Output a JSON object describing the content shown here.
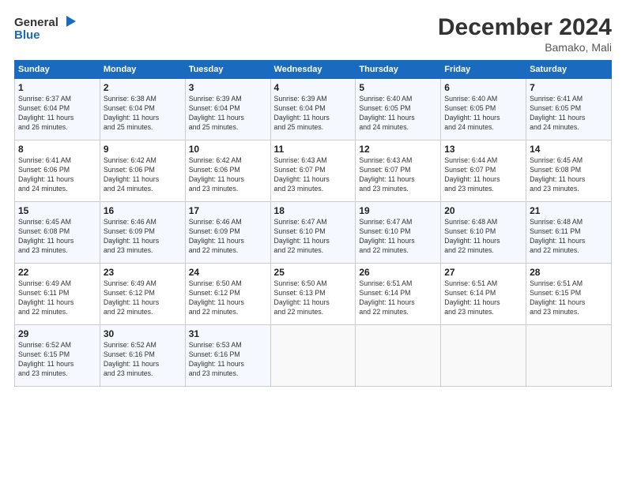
{
  "logo": {
    "line1": "General",
    "line2": "Blue"
  },
  "title": "December 2024",
  "subtitle": "Bamako, Mali",
  "days_header": [
    "Sunday",
    "Monday",
    "Tuesday",
    "Wednesday",
    "Thursday",
    "Friday",
    "Saturday"
  ],
  "weeks": [
    [
      {
        "day": "1",
        "info": "Sunrise: 6:37 AM\nSunset: 6:04 PM\nDaylight: 11 hours\nand 26 minutes."
      },
      {
        "day": "2",
        "info": "Sunrise: 6:38 AM\nSunset: 6:04 PM\nDaylight: 11 hours\nand 25 minutes."
      },
      {
        "day": "3",
        "info": "Sunrise: 6:39 AM\nSunset: 6:04 PM\nDaylight: 11 hours\nand 25 minutes."
      },
      {
        "day": "4",
        "info": "Sunrise: 6:39 AM\nSunset: 6:04 PM\nDaylight: 11 hours\nand 25 minutes."
      },
      {
        "day": "5",
        "info": "Sunrise: 6:40 AM\nSunset: 6:05 PM\nDaylight: 11 hours\nand 24 minutes."
      },
      {
        "day": "6",
        "info": "Sunrise: 6:40 AM\nSunset: 6:05 PM\nDaylight: 11 hours\nand 24 minutes."
      },
      {
        "day": "7",
        "info": "Sunrise: 6:41 AM\nSunset: 6:05 PM\nDaylight: 11 hours\nand 24 minutes."
      }
    ],
    [
      {
        "day": "8",
        "info": "Sunrise: 6:41 AM\nSunset: 6:06 PM\nDaylight: 11 hours\nand 24 minutes."
      },
      {
        "day": "9",
        "info": "Sunrise: 6:42 AM\nSunset: 6:06 PM\nDaylight: 11 hours\nand 24 minutes."
      },
      {
        "day": "10",
        "info": "Sunrise: 6:42 AM\nSunset: 6:06 PM\nDaylight: 11 hours\nand 23 minutes."
      },
      {
        "day": "11",
        "info": "Sunrise: 6:43 AM\nSunset: 6:07 PM\nDaylight: 11 hours\nand 23 minutes."
      },
      {
        "day": "12",
        "info": "Sunrise: 6:43 AM\nSunset: 6:07 PM\nDaylight: 11 hours\nand 23 minutes."
      },
      {
        "day": "13",
        "info": "Sunrise: 6:44 AM\nSunset: 6:07 PM\nDaylight: 11 hours\nand 23 minutes."
      },
      {
        "day": "14",
        "info": "Sunrise: 6:45 AM\nSunset: 6:08 PM\nDaylight: 11 hours\nand 23 minutes."
      }
    ],
    [
      {
        "day": "15",
        "info": "Sunrise: 6:45 AM\nSunset: 6:08 PM\nDaylight: 11 hours\nand 23 minutes."
      },
      {
        "day": "16",
        "info": "Sunrise: 6:46 AM\nSunset: 6:09 PM\nDaylight: 11 hours\nand 23 minutes."
      },
      {
        "day": "17",
        "info": "Sunrise: 6:46 AM\nSunset: 6:09 PM\nDaylight: 11 hours\nand 22 minutes."
      },
      {
        "day": "18",
        "info": "Sunrise: 6:47 AM\nSunset: 6:10 PM\nDaylight: 11 hours\nand 22 minutes."
      },
      {
        "day": "19",
        "info": "Sunrise: 6:47 AM\nSunset: 6:10 PM\nDaylight: 11 hours\nand 22 minutes."
      },
      {
        "day": "20",
        "info": "Sunrise: 6:48 AM\nSunset: 6:10 PM\nDaylight: 11 hours\nand 22 minutes."
      },
      {
        "day": "21",
        "info": "Sunrise: 6:48 AM\nSunset: 6:11 PM\nDaylight: 11 hours\nand 22 minutes."
      }
    ],
    [
      {
        "day": "22",
        "info": "Sunrise: 6:49 AM\nSunset: 6:11 PM\nDaylight: 11 hours\nand 22 minutes."
      },
      {
        "day": "23",
        "info": "Sunrise: 6:49 AM\nSunset: 6:12 PM\nDaylight: 11 hours\nand 22 minutes."
      },
      {
        "day": "24",
        "info": "Sunrise: 6:50 AM\nSunset: 6:12 PM\nDaylight: 11 hours\nand 22 minutes."
      },
      {
        "day": "25",
        "info": "Sunrise: 6:50 AM\nSunset: 6:13 PM\nDaylight: 11 hours\nand 22 minutes."
      },
      {
        "day": "26",
        "info": "Sunrise: 6:51 AM\nSunset: 6:14 PM\nDaylight: 11 hours\nand 22 minutes."
      },
      {
        "day": "27",
        "info": "Sunrise: 6:51 AM\nSunset: 6:14 PM\nDaylight: 11 hours\nand 23 minutes."
      },
      {
        "day": "28",
        "info": "Sunrise: 6:51 AM\nSunset: 6:15 PM\nDaylight: 11 hours\nand 23 minutes."
      }
    ],
    [
      {
        "day": "29",
        "info": "Sunrise: 6:52 AM\nSunset: 6:15 PM\nDaylight: 11 hours\nand 23 minutes."
      },
      {
        "day": "30",
        "info": "Sunrise: 6:52 AM\nSunset: 6:16 PM\nDaylight: 11 hours\nand 23 minutes."
      },
      {
        "day": "31",
        "info": "Sunrise: 6:53 AM\nSunset: 6:16 PM\nDaylight: 11 hours\nand 23 minutes."
      },
      {
        "day": "",
        "info": ""
      },
      {
        "day": "",
        "info": ""
      },
      {
        "day": "",
        "info": ""
      },
      {
        "day": "",
        "info": ""
      }
    ]
  ]
}
